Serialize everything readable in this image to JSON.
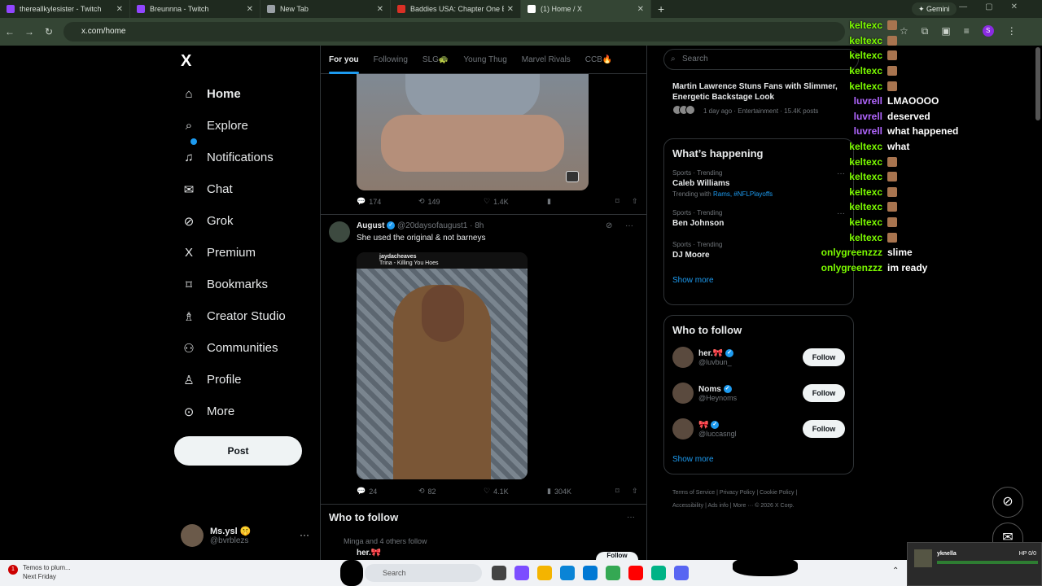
{
  "browser": {
    "tabs": [
      {
        "title": "thereallkylesister - Twitch",
        "color": "#9146ff"
      },
      {
        "title": "Breunnna - Twitch",
        "color": "#9146ff"
      },
      {
        "title": "New Tab",
        "color": "#9aa0a6"
      },
      {
        "title": "Baddies USA: Chapter One Epis",
        "color": "#d93025"
      },
      {
        "title": "(1) Home / X",
        "color": "#ffffff"
      }
    ],
    "gemini_label": "Gemini",
    "url": "x.com/home",
    "profile_initial": "S"
  },
  "sidebar": {
    "logo": "X",
    "items": [
      {
        "label": "Home",
        "icon": "⌂"
      },
      {
        "label": "Explore",
        "icon": "⌕"
      },
      {
        "label": "Notifications",
        "icon": "♫"
      },
      {
        "label": "Chat",
        "icon": "✉"
      },
      {
        "label": "Grok",
        "icon": "⊘"
      },
      {
        "label": "Premium",
        "icon": "X"
      },
      {
        "label": "Bookmarks",
        "icon": "⌑"
      },
      {
        "label": "Creator Studio",
        "icon": "♗"
      },
      {
        "label": "Communities",
        "icon": "⚇"
      },
      {
        "label": "Profile",
        "icon": "♙"
      },
      {
        "label": "More",
        "icon": "⊙"
      }
    ],
    "post_label": "Post",
    "account": {
      "name": "Ms.ysl 🤫",
      "handle": "@bvrblezs"
    }
  },
  "feed": {
    "tabs": [
      "For you",
      "Following",
      "SLG🐢",
      "Young Thug",
      "Marvel Rivals",
      "CCB🔥"
    ],
    "tweet1_actions": {
      "replies": "174",
      "reposts": "149",
      "likes": "1.4K",
      "views": ""
    },
    "tweet2": {
      "name": "August",
      "handle": "@20daysofaugust1 · 8h",
      "text": "She used the  original & not barneys",
      "media_user": "jaydacheaves",
      "media_song": "Trina - Killing You Hoes",
      "actions": {
        "replies": "24",
        "reposts": "82",
        "likes": "4.1K",
        "views": "304K"
      }
    },
    "who_to_follow": {
      "title": "Who to follow",
      "subtitle": "Minga and 4 others follow",
      "name": "her.🎀",
      "button": "Follow"
    }
  },
  "right": {
    "search_placeholder": "Search",
    "news": {
      "title": "Martin Lawrence Stuns Fans with Slimmer, Energetic Backstage Look",
      "meta": "1 day ago · Entertainment · 15.4K posts"
    },
    "happening": {
      "title": "What’s happening",
      "trends": [
        {
          "category": "Sports · Trending",
          "name": "Caleb Williams",
          "with_label": "Trending with",
          "with_links": "Rams, #NFLPlayoffs"
        },
        {
          "category": "Sports · Trending",
          "name": "Ben Johnson",
          "with_label": "",
          "with_links": ""
        },
        {
          "category": "Sports · Trending",
          "name": "DJ Moore",
          "with_label": "",
          "with_links": ""
        }
      ],
      "show_more": "Show more"
    },
    "follow": {
      "title": "Who to follow",
      "people": [
        {
          "name": "her.🎀",
          "handle": "@luvbun_",
          "button": "Follow"
        },
        {
          "name": "Noms",
          "handle": "@Heynoms",
          "button": "Follow"
        },
        {
          "name": "🎀",
          "handle": "@luccasngl",
          "button": "Follow"
        }
      ],
      "show_more": "Show more"
    },
    "footer": {
      "line1": "Terms of Service  |  Privacy Policy  |  Cookie Policy  |",
      "line2": "Accessibility  |  Ads info  |  More ···  © 2026 X Corp."
    }
  },
  "chat": [
    {
      "user": "keltexc",
      "color": "#7cfc00",
      "msg": "",
      "emote": true
    },
    {
      "user": "keltexc",
      "color": "#7cfc00",
      "msg": "",
      "emote": true
    },
    {
      "user": "keltexc",
      "color": "#7cfc00",
      "msg": "",
      "emote": true
    },
    {
      "user": "keltexc",
      "color": "#7cfc00",
      "msg": "",
      "emote": true
    },
    {
      "user": "keltexc",
      "color": "#7cfc00",
      "msg": "",
      "emote": true
    },
    {
      "user": "luvrell",
      "color": "#b266ff",
      "msg": "LMAOOOO",
      "emote": false
    },
    {
      "user": "luvrell",
      "color": "#b266ff",
      "msg": "deserved",
      "emote": false
    },
    {
      "user": "luvrell",
      "color": "#b266ff",
      "msg": "what happened",
      "emote": false
    },
    {
      "user": "keltexc",
      "color": "#7cfc00",
      "msg": "what",
      "emote": false
    },
    {
      "user": "keltexc",
      "color": "#7cfc00",
      "msg": "",
      "emote": true
    },
    {
      "user": "keltexc",
      "color": "#7cfc00",
      "msg": "",
      "emote": true
    },
    {
      "user": "keltexc",
      "color": "#7cfc00",
      "msg": "",
      "emote": true
    },
    {
      "user": "keltexc",
      "color": "#7cfc00",
      "msg": "",
      "emote": true
    },
    {
      "user": "keltexc",
      "color": "#7cfc00",
      "msg": "",
      "emote": true
    },
    {
      "user": "keltexc",
      "color": "#7cfc00",
      "msg": "",
      "emote": true
    },
    {
      "user": "onlygreenzzz",
      "color": "#7cfc00",
      "msg": "slime",
      "emote": false
    },
    {
      "user": "onlygreenzzz",
      "color": "#7cfc00",
      "msg": "im ready",
      "emote": false
    }
  ],
  "taskbar": {
    "notif_count": "1",
    "notif_line1": "Temos to plum...",
    "notif_line2": "Next Friday",
    "search_placeholder": "Search"
  },
  "mini_player": {
    "name": "yknella",
    "hp": "HP 0/0"
  }
}
